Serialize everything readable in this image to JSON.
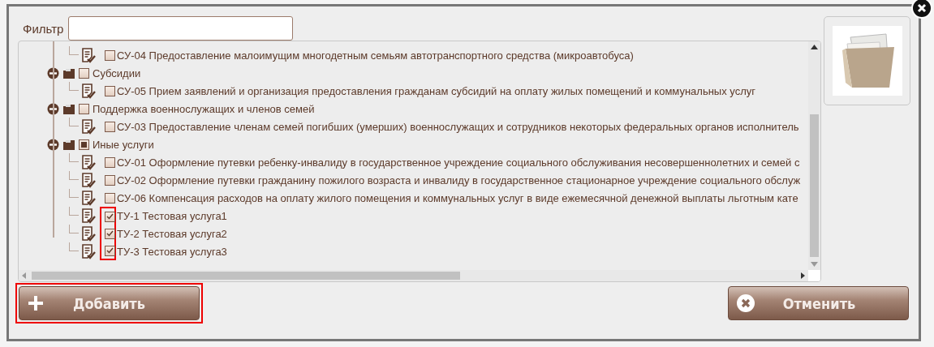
{
  "filter": {
    "label": "Фильтр"
  },
  "tree": [
    {
      "kind": "leaf",
      "label": "СУ-04 Предоставление малоимущим многодетным семьям автотранспортного средства (микроавтобуса)",
      "checked": false,
      "highlighted": false
    },
    {
      "kind": "group",
      "label": "Субсидии",
      "expanded": true,
      "checked": false,
      "partial": false,
      "children": [
        {
          "label": "СУ-05 Прием заявлений и организация предоставления гражданам субсидий на оплату жилых помещений и коммунальных услуг",
          "checked": false,
          "highlighted": false
        }
      ]
    },
    {
      "kind": "group",
      "label": "Поддержка военнослужащих и членов семей",
      "expanded": true,
      "checked": false,
      "partial": false,
      "children": [
        {
          "label": "СУ-03 Предоставление членам семей погибших (умерших) военнослужащих и сотрудников некоторых федеральных органов исполнитель",
          "checked": false,
          "highlighted": false
        }
      ]
    },
    {
      "kind": "group",
      "label": "Иные услуги",
      "expanded": true,
      "checked": false,
      "partial": true,
      "children": [
        {
          "label": "СУ-01 Оформление путевки ребенку-инвалиду в государственное учреждение социального обслуживания несовершеннолетних и семей с",
          "checked": false,
          "highlighted": false
        },
        {
          "label": "СУ-02 Оформление путевки гражданину пожилого возраста и инвалиду в государственное стационарное учреждение социального обслуж",
          "checked": false,
          "highlighted": false
        },
        {
          "label": "СУ-06 Компенсация расходов на оплату жилого помещения и коммунальных услуг в виде ежемесячной денежной выплаты льготным кате",
          "checked": false,
          "highlighted": false
        },
        {
          "label": "ТУ-1 Тестовая услуга1",
          "checked": true,
          "highlighted": true
        },
        {
          "label": "ТУ-2 Тестовая услуга2",
          "checked": true,
          "highlighted": true
        },
        {
          "label": "ТУ-3 Тестовая услуга3",
          "checked": true,
          "highlighted": true
        }
      ]
    }
  ],
  "buttons": [
    {
      "kind": "add",
      "label": "Добавить",
      "highlighted": true
    },
    {
      "kind": "cancel",
      "label": "Отменить",
      "highlighted": false
    }
  ]
}
